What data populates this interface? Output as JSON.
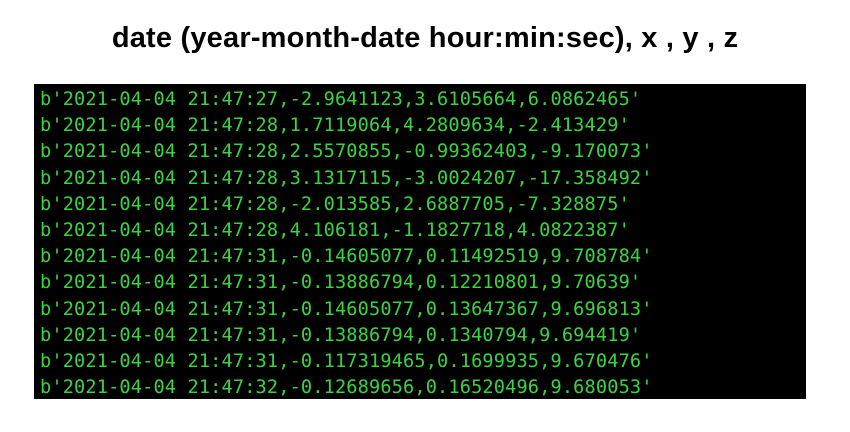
{
  "heading": "date (year-month-date hour:min:sec), x , y , z",
  "terminal": {
    "text_color": "#39d43f",
    "background": "#000000",
    "lines": [
      "b'2021-04-04 21:47:27,-2.9641123,3.6105664,6.0862465'",
      "b'2021-04-04 21:47:28,1.7119064,4.2809634,-2.413429'",
      "b'2021-04-04 21:47:28,2.5570855,-0.99362403,-9.170073'",
      "b'2021-04-04 21:47:28,3.1317115,-3.0024207,-17.358492'",
      "b'2021-04-04 21:47:28,-2.013585,2.6887705,-7.328875'",
      "b'2021-04-04 21:47:28,4.106181,-1.1827718,4.0822387'",
      "b'2021-04-04 21:47:31,-0.14605077,0.11492519,9.708784'",
      "b'2021-04-04 21:47:31,-0.13886794,0.12210801,9.70639'",
      "b'2021-04-04 21:47:31,-0.14605077,0.13647367,9.696813'",
      "b'2021-04-04 21:47:31,-0.13886794,0.1340794,9.694419'",
      "b'2021-04-04 21:47:31,-0.117319465,0.1699935,9.670476'",
      "b'2021-04-04 21:47:32,-0.12689656,0.16520496,9.680053'"
    ]
  }
}
